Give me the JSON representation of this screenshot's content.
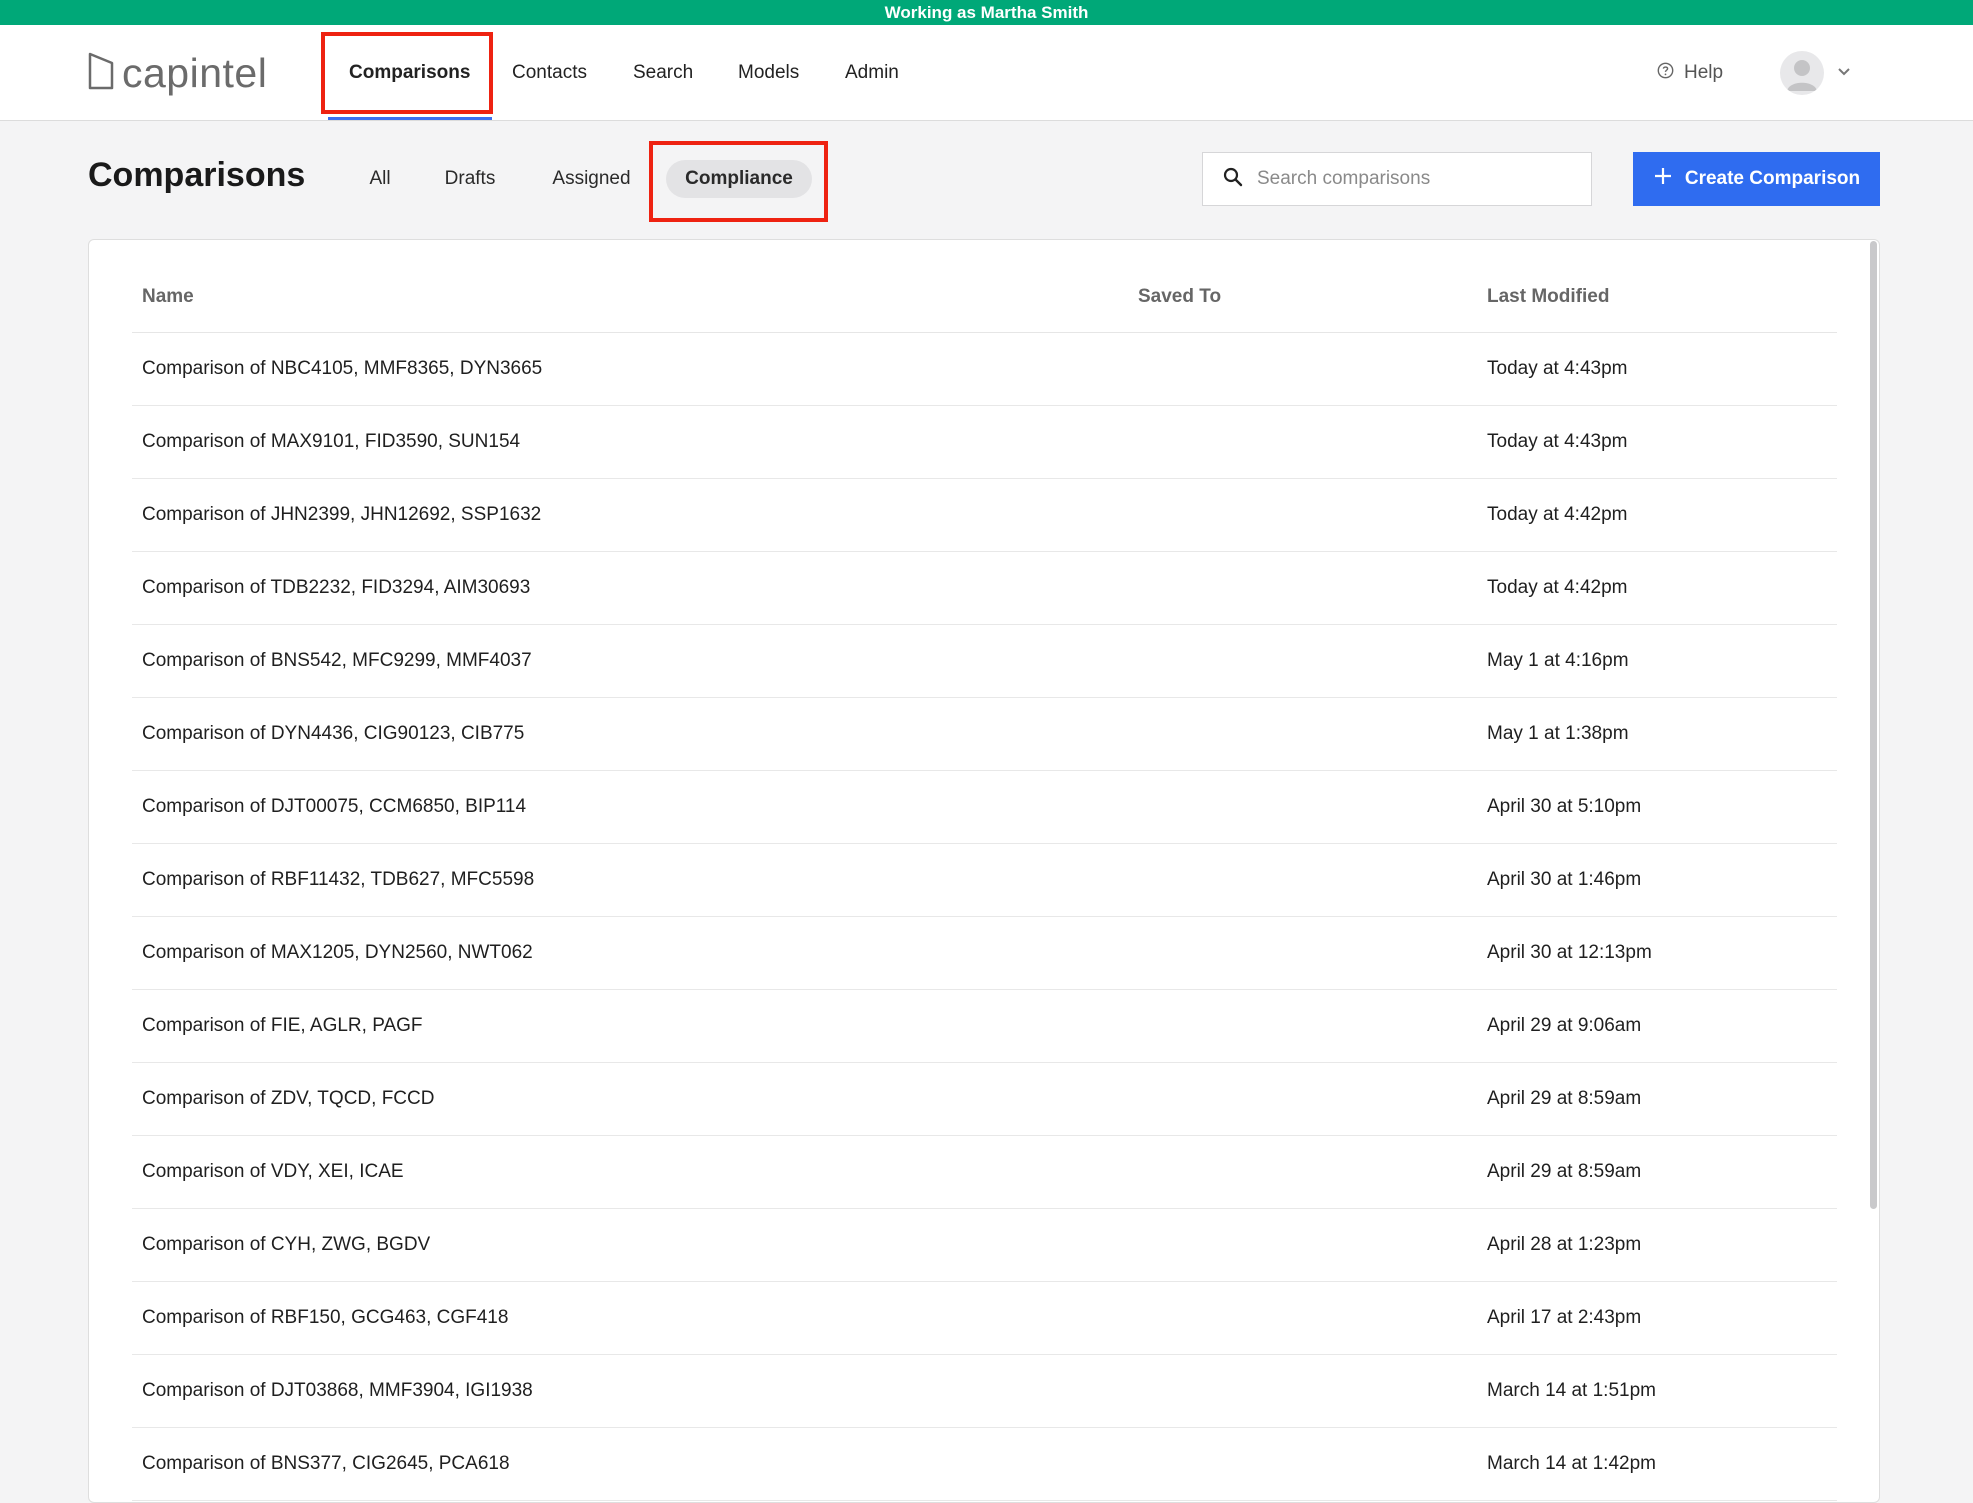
{
  "banner": {
    "text": "Working as Martha Smith"
  },
  "logo": {
    "text": "capintel"
  },
  "nav": {
    "items": [
      {
        "label": "Comparisons",
        "active": true
      },
      {
        "label": "Contacts"
      },
      {
        "label": "Search"
      },
      {
        "label": "Models"
      },
      {
        "label": "Admin"
      }
    ],
    "help_label": "Help"
  },
  "page": {
    "title": "Comparisons",
    "filters": [
      {
        "label": "All"
      },
      {
        "label": "Drafts"
      },
      {
        "label": "Assigned"
      },
      {
        "label": "Compliance",
        "active": true
      }
    ],
    "search_placeholder": "Search comparisons",
    "create_label": "Create Comparison"
  },
  "table": {
    "headers": {
      "name": "Name",
      "saved_to": "Saved To",
      "last_modified": "Last Modified"
    },
    "rows": [
      {
        "name": "Comparison of NBC4105, MMF8365, DYN3665",
        "saved_to": "",
        "modified": "Today at 4:43pm"
      },
      {
        "name": "Comparison of MAX9101, FID3590, SUN154",
        "saved_to": "",
        "modified": "Today at 4:43pm"
      },
      {
        "name": "Comparison of JHN2399, JHN12692, SSP1632",
        "saved_to": "",
        "modified": "Today at 4:42pm"
      },
      {
        "name": "Comparison of TDB2232, FID3294, AIM30693",
        "saved_to": "",
        "modified": "Today at 4:42pm"
      },
      {
        "name": "Comparison of BNS542, MFC9299, MMF4037",
        "saved_to": "",
        "modified": "May 1 at 4:16pm"
      },
      {
        "name": "Comparison of DYN4436, CIG90123, CIB775",
        "saved_to": "",
        "modified": "May 1 at 1:38pm"
      },
      {
        "name": "Comparison of DJT00075, CCM6850, BIP114",
        "saved_to": "",
        "modified": "April 30 at 5:10pm"
      },
      {
        "name": "Comparison of RBF11432, TDB627, MFC5598",
        "saved_to": "",
        "modified": "April 30 at 1:46pm"
      },
      {
        "name": "Comparison of MAX1205, DYN2560, NWT062",
        "saved_to": "",
        "modified": "April 30 at 12:13pm"
      },
      {
        "name": "Comparison of FIE, AGLR, PAGF",
        "saved_to": "",
        "modified": "April 29 at 9:06am"
      },
      {
        "name": "Comparison of ZDV, TQCD, FCCD",
        "saved_to": "",
        "modified": "April 29 at 8:59am"
      },
      {
        "name": "Comparison of VDY, XEI, ICAE",
        "saved_to": "",
        "modified": "April 29 at 8:59am"
      },
      {
        "name": "Comparison of CYH, ZWG, BGDV",
        "saved_to": "",
        "modified": "April 28 at 1:23pm"
      },
      {
        "name": "Comparison of RBF150, GCG463, CGF418",
        "saved_to": "",
        "modified": "April 17 at 2:43pm"
      },
      {
        "name": "Comparison of DJT03868, MMF3904, IGI1938",
        "saved_to": "",
        "modified": "March 14 at 1:51pm"
      },
      {
        "name": "Comparison of BNS377, CIG2645, PCA618",
        "saved_to": "",
        "modified": "March 14 at 1:42pm"
      }
    ]
  },
  "colors": {
    "banner": "#00a878",
    "primary": "#2f6cf0",
    "highlight": "#ee2211"
  },
  "icons": [
    "logo-mark-icon",
    "help-circle-icon",
    "user-avatar-icon",
    "chevron-down-icon",
    "search-icon",
    "plus-icon"
  ]
}
